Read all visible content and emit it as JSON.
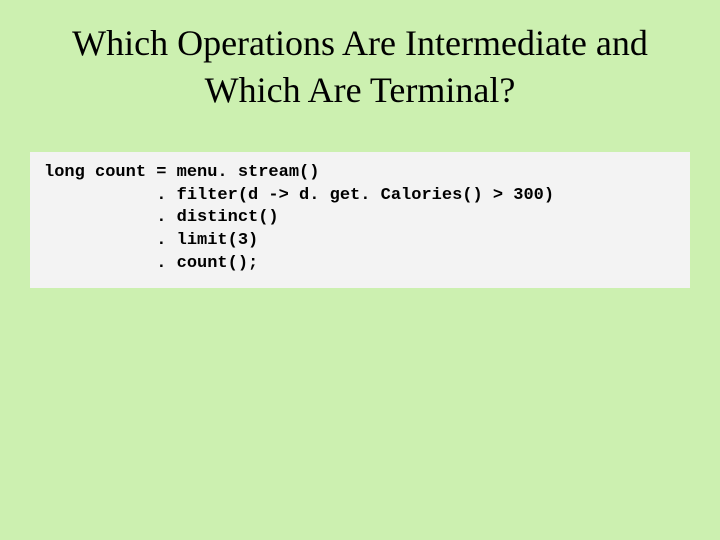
{
  "slide": {
    "title_line1": "Which Operations Are Intermediate and",
    "title_line2": "Which Are Terminal?",
    "code": "long count = menu. stream()\n           . filter(d -> d. get. Calories() > 300)\n           . distinct()\n           . limit(3)\n           . count();"
  }
}
